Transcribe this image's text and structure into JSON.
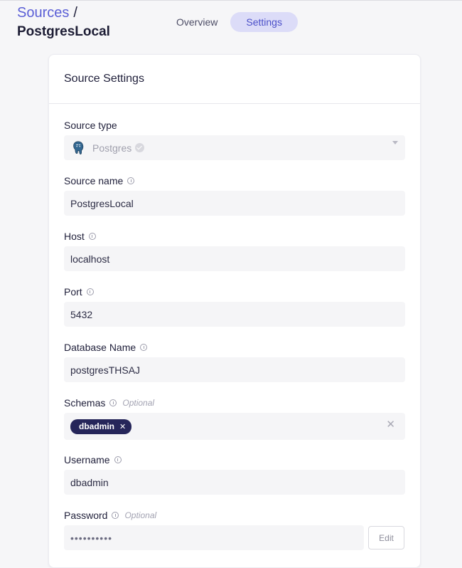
{
  "breadcrumb": {
    "parent": "Sources",
    "separator": "/",
    "current": "PostgresLocal"
  },
  "tabs": [
    {
      "label": "Overview",
      "active": false
    },
    {
      "label": "Settings",
      "active": true
    }
  ],
  "card": {
    "title": "Source Settings",
    "fields": {
      "source_type": {
        "label": "Source type",
        "value": "Postgres",
        "icon": "postgres-elephant-icon"
      },
      "source_name": {
        "label": "Source name",
        "value": "PostgresLocal"
      },
      "host": {
        "label": "Host",
        "value": "localhost"
      },
      "port": {
        "label": "Port",
        "value": "5432"
      },
      "database_name": {
        "label": "Database Name",
        "value": "postgresTHSAJ"
      },
      "schemas": {
        "label": "Schemas",
        "optional": "Optional",
        "tags": [
          "dbadmin"
        ]
      },
      "username": {
        "label": "Username",
        "value": "dbadmin"
      },
      "password": {
        "label": "Password",
        "optional": "Optional",
        "value": "••••••••••",
        "edit_label": "Edit"
      }
    }
  },
  "colors": {
    "accent": "#5b5fd6",
    "tag_bg": "#26265a",
    "active_tab_bg": "#dcdcf8"
  }
}
